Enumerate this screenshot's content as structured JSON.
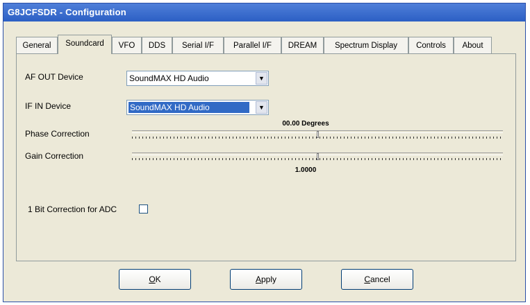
{
  "window": {
    "title": "G8JCFSDR - Configuration"
  },
  "tabs": [
    {
      "label": "General"
    },
    {
      "label": "Soundcard"
    },
    {
      "label": "VFO"
    },
    {
      "label": "DDS"
    },
    {
      "label": "Serial I/F"
    },
    {
      "label": "Parallel I/F"
    },
    {
      "label": "DREAM"
    },
    {
      "label": "Spectrum Display"
    },
    {
      "label": "Controls"
    },
    {
      "label": "About"
    }
  ],
  "active_tab": "Soundcard",
  "soundcard": {
    "af_out_label": "AF OUT Device",
    "af_out_value": "SoundMAX HD Audio",
    "if_in_label": "IF IN Device",
    "if_in_value": "SoundMAX HD Audio",
    "phase_label": "Phase Correction",
    "phase_value": "00.00 Degrees",
    "phase_level": 0.5,
    "gain_label": "Gain Correction",
    "gain_value": "1.0000",
    "gain_level": 0.5,
    "bit_correction_label": "1 Bit Correction for ADC",
    "bit_correction_checked": false
  },
  "buttons": {
    "ok_pre": "",
    "ok_u": "O",
    "ok_post": "K",
    "apply_pre": "",
    "apply_u": "A",
    "apply_post": "pply",
    "cancel_pre": "",
    "cancel_u": "C",
    "cancel_post": "ancel"
  }
}
